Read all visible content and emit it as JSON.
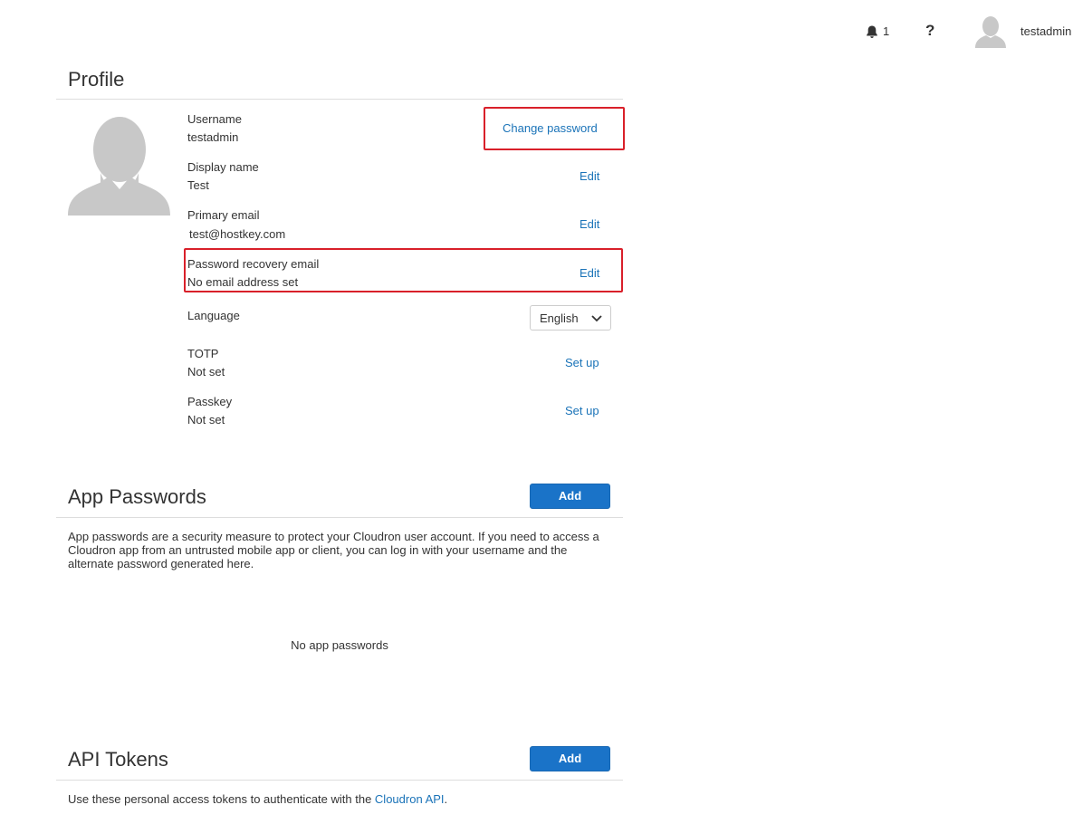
{
  "topbar": {
    "notification_count": "1",
    "help_label": "?",
    "username": "testadmin"
  },
  "profile": {
    "title": "Profile",
    "username_label": "Username",
    "username_value": "testadmin",
    "change_password_label": "Change password",
    "display_name_label": "Display name",
    "display_name_value": "Test",
    "primary_email_label": "Primary email",
    "primary_email_value": "test@hostkey.com",
    "recovery_email_label": "Password recovery email",
    "recovery_email_value": "No email address set",
    "edit_label": "Edit",
    "language_label": "Language",
    "language_value": "English",
    "totp_label": "TOTP",
    "totp_value": "Not set",
    "passkey_label": "Passkey",
    "passkey_value": "Not set",
    "setup_label": "Set up"
  },
  "app_passwords": {
    "title": "App Passwords",
    "add_label": "Add",
    "description": "App passwords are a security measure to protect your Cloudron user account. If you need to access a Cloudron app from an untrusted mobile app or client, you can log in with your username and the alternate password generated here.",
    "empty_text": "No app passwords"
  },
  "api_tokens": {
    "title": "API Tokens",
    "add_label": "Add",
    "description_prefix": "Use these personal access tokens to authenticate with the ",
    "description_link": "Cloudron API",
    "description_suffix": "."
  },
  "colors": {
    "link": "#1a73b8",
    "primary_button": "#1a73c8",
    "highlight": "#d9202a",
    "avatar_gray": "#c8c8c8"
  },
  "icons": {
    "notifications": "bell-icon",
    "help": "question-icon",
    "avatar": "user-silhouette-icon",
    "dropdown": "chevron-down-icon"
  }
}
